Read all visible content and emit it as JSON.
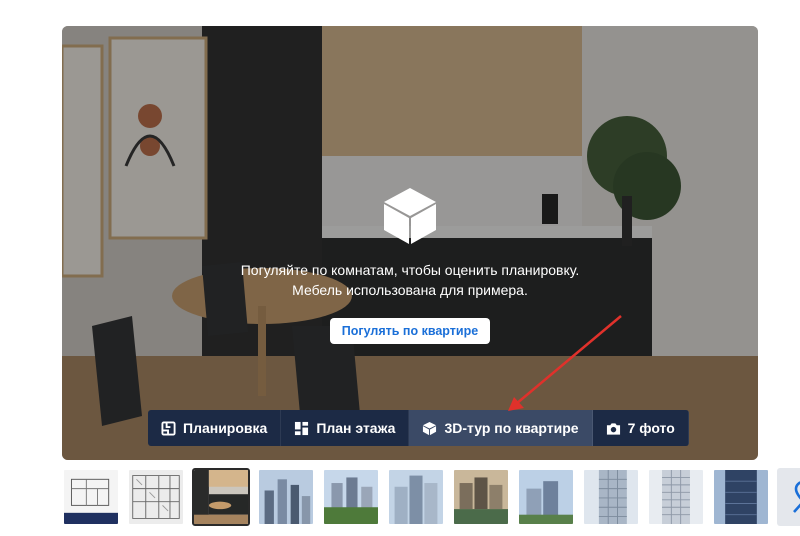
{
  "overlay": {
    "icon": "cube-icon",
    "line1": "Погуляйте по комнатам, чтобы оценить планировку.",
    "line2": "Мебель использована для примера.",
    "button_label": "Погулять по квартире"
  },
  "tabs": [
    {
      "icon": "floorplan-icon",
      "label": "Планировка",
      "active": false
    },
    {
      "icon": "floor-plan-icon",
      "label": "План этажа",
      "active": false
    },
    {
      "icon": "cube-icon",
      "label": "3D-тур по квартире",
      "active": true
    },
    {
      "icon": "camera-icon",
      "label": "7 фото",
      "active": false
    }
  ],
  "thumbnails": [
    "plan-document",
    "floor-plan",
    "kitchen-photo",
    "city-towers",
    "park-buildings",
    "residential-towers",
    "waterfront-buildings",
    "building-aerial",
    "facade-closeup",
    "tower-highrise",
    "tower-glass"
  ],
  "map_thumbnail": {
    "icon": "map-pin-icon"
  },
  "colors": {
    "tabbar_bg": "#1c2a45",
    "tab_active_bg": "#3b4a66",
    "button_text": "#1a6fd8",
    "arrow": "#e0312b",
    "pin": "#1a6fd8"
  }
}
